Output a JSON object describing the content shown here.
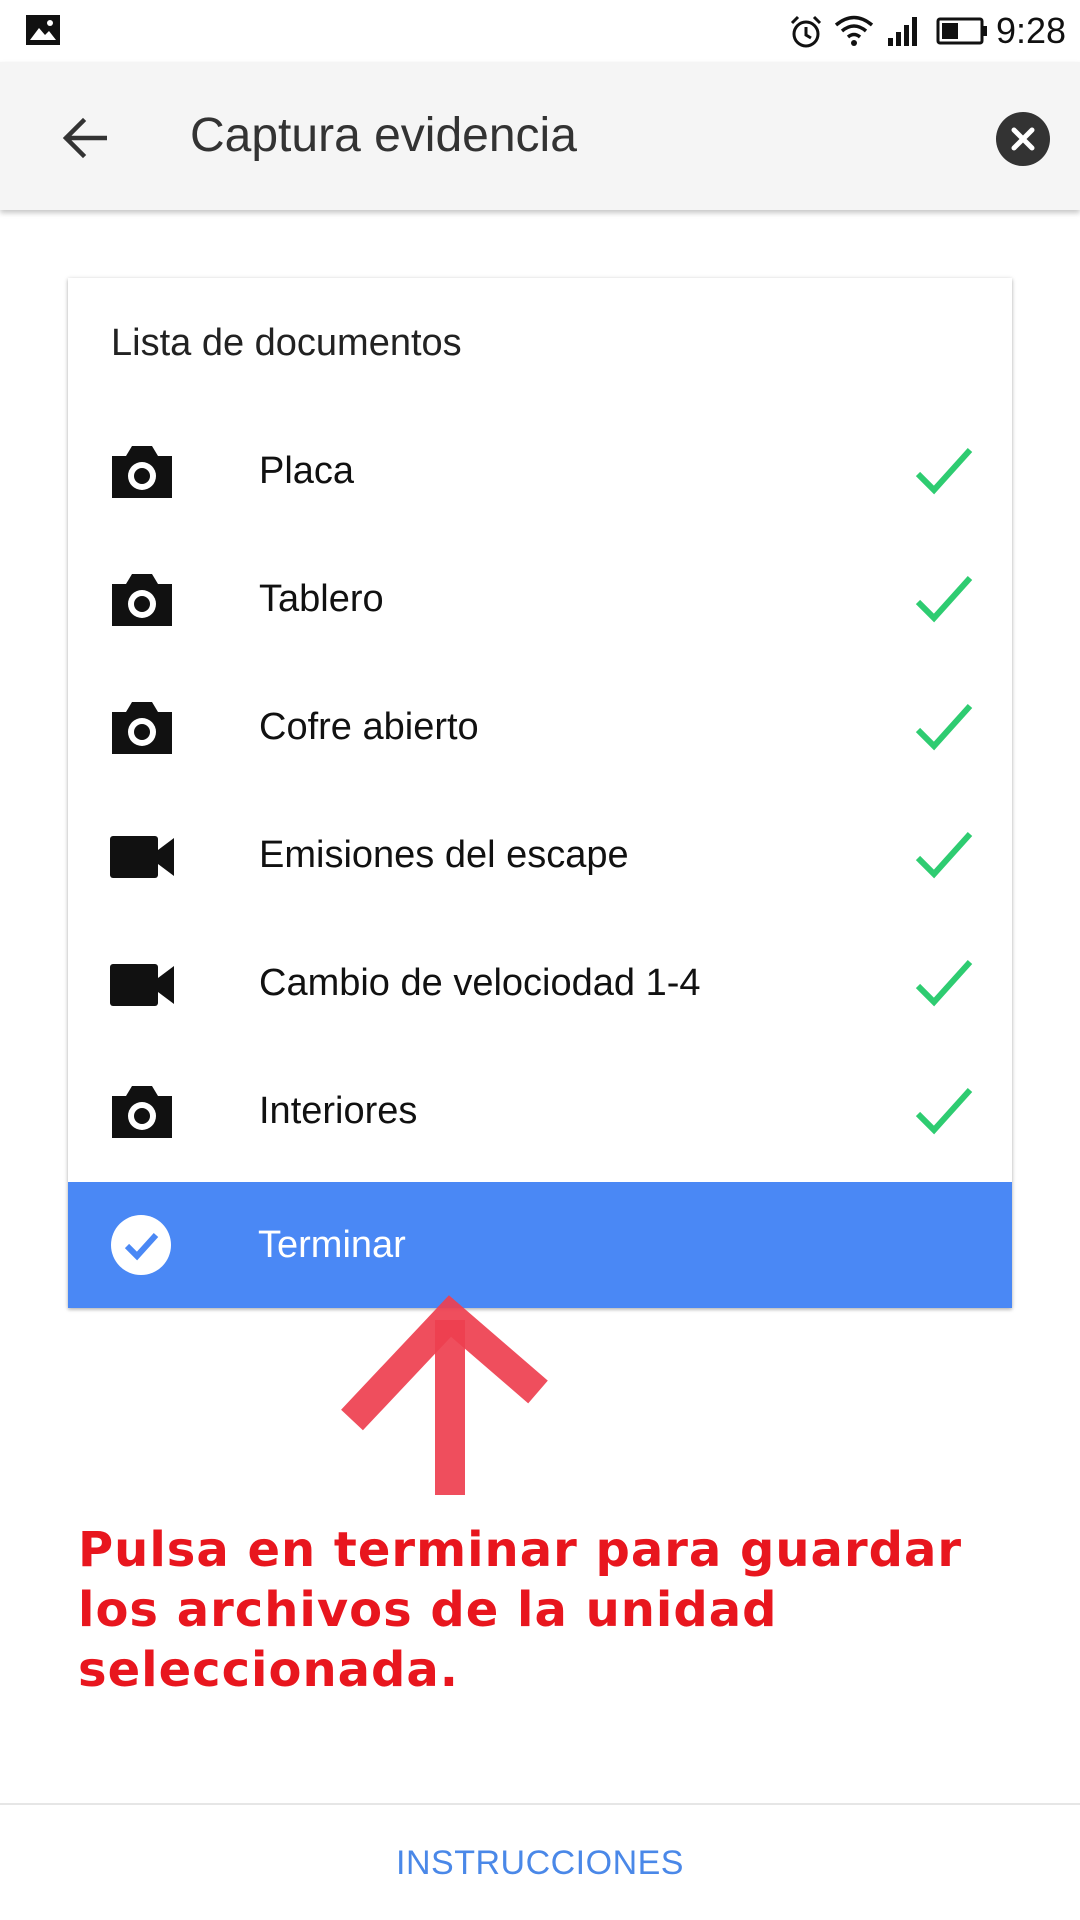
{
  "status_bar": {
    "time": "9:28",
    "icons": [
      "gallery-icon",
      "alarm-icon",
      "wifi-icon",
      "signal-icon",
      "battery-icon"
    ]
  },
  "app_bar": {
    "title": "Captura evidencia",
    "back_icon": "arrow-back-icon",
    "close_icon": "close-circle-icon"
  },
  "card": {
    "title": "Lista de documentos",
    "items": [
      {
        "label": "Placa",
        "icon": "camera-icon",
        "status": "check-icon"
      },
      {
        "label": "Tablero",
        "icon": "camera-icon",
        "status": "check-icon"
      },
      {
        "label": "Cofre abierto",
        "icon": "camera-icon",
        "status": "check-icon"
      },
      {
        "label": "Emisiones del escape",
        "icon": "video-camera-icon",
        "status": "check-icon"
      },
      {
        "label": "Cambio de velociodad 1-4",
        "icon": "video-camera-icon",
        "status": "check-icon"
      },
      {
        "label": "Interiores",
        "icon": "camera-icon",
        "status": "check-icon"
      }
    ],
    "finish": {
      "label": "Terminar",
      "icon": "check-circle-icon"
    }
  },
  "annotation": {
    "text": "Pulsa en terminar para guardar los archivos de la unidad seleccionada.",
    "arrow": "red-arrow-up-icon",
    "color": "#e8161e"
  },
  "bottom_bar": {
    "button_label": "INSTRUCCIONES"
  },
  "colors": {
    "accent": "#4a88f5",
    "check": "#2ecc71",
    "link": "#4a88e8"
  }
}
